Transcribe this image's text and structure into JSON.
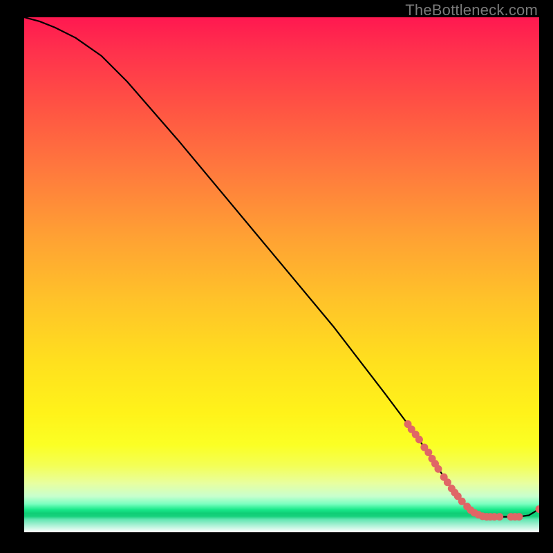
{
  "watermark": "TheBottleneck.com",
  "chart_data": {
    "type": "line",
    "title": "",
    "xlabel": "",
    "ylabel": "",
    "xlim": [
      0,
      100
    ],
    "ylim": [
      0,
      100
    ],
    "grid": false,
    "curve": [
      {
        "x": 0,
        "y": 100
      },
      {
        "x": 3,
        "y": 99.2
      },
      {
        "x": 6,
        "y": 98.0
      },
      {
        "x": 10,
        "y": 96.0
      },
      {
        "x": 15,
        "y": 92.5
      },
      {
        "x": 20,
        "y": 87.5
      },
      {
        "x": 30,
        "y": 76.0
      },
      {
        "x": 40,
        "y": 64.0
      },
      {
        "x": 50,
        "y": 52.0
      },
      {
        "x": 60,
        "y": 40.0
      },
      {
        "x": 70,
        "y": 27.0
      },
      {
        "x": 76,
        "y": 19.0
      },
      {
        "x": 80,
        "y": 13.0
      },
      {
        "x": 83,
        "y": 8.5
      },
      {
        "x": 86,
        "y": 5.0
      },
      {
        "x": 88,
        "y": 3.5
      },
      {
        "x": 90,
        "y": 3.0
      },
      {
        "x": 93,
        "y": 3.0
      },
      {
        "x": 96,
        "y": 3.0
      },
      {
        "x": 98,
        "y": 3.3
      },
      {
        "x": 100,
        "y": 4.5
      }
    ],
    "points": [
      {
        "x": 74.5,
        "y": 21.0
      },
      {
        "x": 75.2,
        "y": 20.0
      },
      {
        "x": 76.0,
        "y": 19.0
      },
      {
        "x": 76.7,
        "y": 18.0
      },
      {
        "x": 77.7,
        "y": 16.5
      },
      {
        "x": 78.5,
        "y": 15.5
      },
      {
        "x": 79.2,
        "y": 14.3
      },
      {
        "x": 79.8,
        "y": 13.3
      },
      {
        "x": 80.4,
        "y": 12.3
      },
      {
        "x": 81.5,
        "y": 10.7
      },
      {
        "x": 82.2,
        "y": 9.7
      },
      {
        "x": 83.0,
        "y": 8.5
      },
      {
        "x": 83.6,
        "y": 7.7
      },
      {
        "x": 84.2,
        "y": 7.0
      },
      {
        "x": 85.0,
        "y": 6.0
      },
      {
        "x": 86.0,
        "y": 5.0
      },
      {
        "x": 86.7,
        "y": 4.3
      },
      {
        "x": 87.4,
        "y": 3.8
      },
      {
        "x": 88.2,
        "y": 3.4
      },
      {
        "x": 89.0,
        "y": 3.1
      },
      {
        "x": 89.8,
        "y": 3.0
      },
      {
        "x": 90.5,
        "y": 3.0
      },
      {
        "x": 91.3,
        "y": 3.0
      },
      {
        "x": 92.3,
        "y": 3.0
      },
      {
        "x": 94.5,
        "y": 3.0
      },
      {
        "x": 95.3,
        "y": 3.0
      },
      {
        "x": 96.1,
        "y": 3.0
      },
      {
        "x": 100.0,
        "y": 4.5
      }
    ],
    "point_color": "#e06666",
    "curve_color": "#000000"
  }
}
